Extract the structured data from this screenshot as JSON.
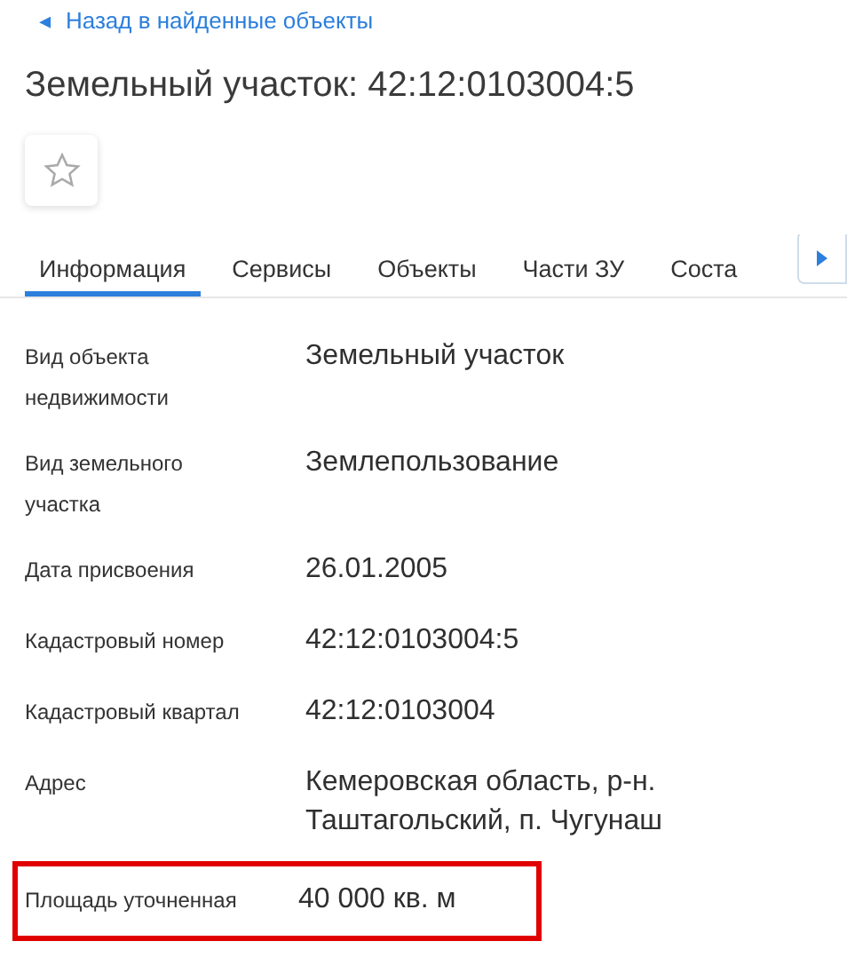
{
  "back_link": {
    "arrow": "◂",
    "label": "Назад в найденные объекты"
  },
  "title": "Земельный участок: 42:12:0103004:5",
  "favorite": {
    "selected": false
  },
  "tabs": [
    {
      "label": "Информация",
      "selected": true
    },
    {
      "label": "Сервисы",
      "selected": false
    },
    {
      "label": "Объекты",
      "selected": false
    },
    {
      "label": "Части ЗУ",
      "selected": false
    },
    {
      "label": "Соста",
      "selected": false
    }
  ],
  "fields": [
    {
      "label": "Вид объекта недвижимости",
      "value": "Земельный участок",
      "highlighted": false
    },
    {
      "label": "Вид земельного участка",
      "value": "Землепользование",
      "highlighted": false
    },
    {
      "label": "Дата присвоения",
      "value": "26.01.2005",
      "highlighted": false
    },
    {
      "label": "Кадастровый номер",
      "value": "42:12:0103004:5",
      "highlighted": false
    },
    {
      "label": "Кадастровый квартал",
      "value": "42:12:0103004",
      "highlighted": false
    },
    {
      "label": "Адрес",
      "value": "Кемеровская область, р-н. Таштагольский, п. Чугунаш",
      "highlighted": false
    },
    {
      "label": "Площадь уточненная",
      "value": "40 000 кв. м",
      "highlighted": true
    }
  ]
}
